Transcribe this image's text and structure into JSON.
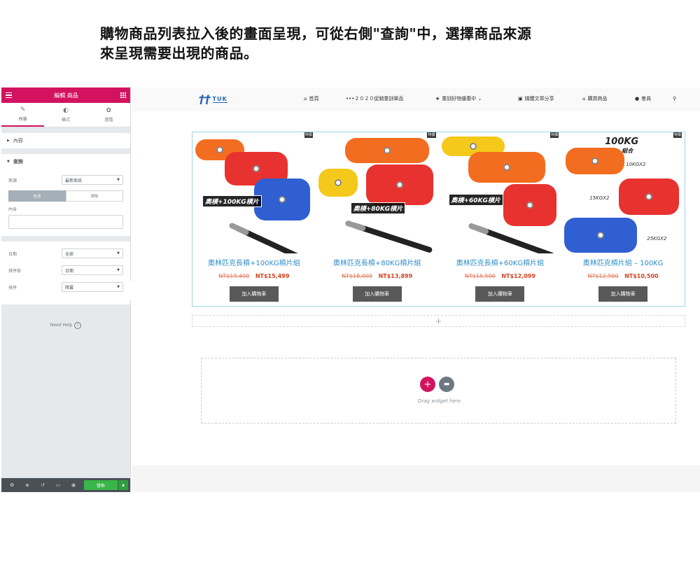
{
  "caption": {
    "line1": "購物商品列表拉入後的畫面呈現，可從右側\"查詢\"中，選擇商品來源",
    "line2": "來呈現需要出現的商品。"
  },
  "editor": {
    "title": "編輯 商品",
    "tabs": [
      {
        "label": "內容",
        "icon": "pencil-icon"
      },
      {
        "label": "樣式",
        "icon": "contrast-icon"
      },
      {
        "label": "進階",
        "icon": "gear-icon"
      }
    ],
    "sections": {
      "content": "內容",
      "query": "查詢"
    },
    "query": {
      "source_label": "來源",
      "source_value": "最新商品",
      "include_label": "包含",
      "exclude_label": "排除",
      "contains_label": "內含",
      "date_label": "日期",
      "date_value": "全部",
      "orderby_label": "排序依",
      "orderby_value": "日期",
      "order_label": "排序",
      "order_value": "降冪"
    },
    "need_help": "Need Help",
    "publish": "發佈"
  },
  "site": {
    "logo_mark": "ϯϯ",
    "logo_text": "TUK",
    "nav": [
      {
        "label": "首頁",
        "icon": "home-icon"
      },
      {
        "label": "•••２０２０促銷重訓單品",
        "icon": ""
      },
      {
        "label": "重訓好物優惠中 ⌄",
        "icon": "star-icon"
      },
      {
        "label": "媒體文章分享",
        "icon": "book-icon"
      },
      {
        "label": "購買商品",
        "icon": "store-icon"
      },
      {
        "label": "會員",
        "icon": "user-icon"
      }
    ]
  },
  "products": [
    {
      "badge": "特價",
      "image_label": "奧槓+100KG槓片",
      "name": "奧林匹克長槓+100KG槓片組",
      "old_price": "NT$19,400",
      "new_price": "NT$15,499",
      "button": "加入購物車"
    },
    {
      "badge": "特價",
      "image_label": "奧槓+80KG槓片",
      "name": "奧林匹克長槓+80KG槓片組",
      "old_price": "NT$18,000",
      "new_price": "NT$13,899",
      "button": "加入購物車"
    },
    {
      "badge": "特價",
      "image_label": "奧槓+60KG槓片",
      "name": "奧林匹克長槓+60KG槓片組",
      "old_price": "NT$15,500",
      "new_price": "NT$12,099",
      "button": "加入購物車"
    },
    {
      "badge": "特價",
      "image_label": "",
      "name": "奧林匹克槓片組 – 100KG",
      "old_price": "NT$12,900",
      "new_price": "NT$10,500",
      "button": "加入購物車",
      "set_title": "100KG",
      "set_sub": "組合",
      "set_specs": [
        "10KGX2",
        "15KGX2",
        "25KGX2"
      ]
    }
  ],
  "dropzone": {
    "text": "Drag widget here"
  },
  "colors": {
    "accent": "#d3135f",
    "link": "#2c8cc9",
    "sale": "#d4401e",
    "publish": "#39b54a"
  }
}
